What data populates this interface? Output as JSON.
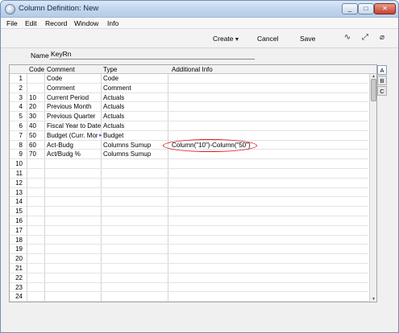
{
  "window": {
    "title": "Column Definition: New"
  },
  "menu": [
    "File",
    "Edit",
    "Record",
    "Window",
    "Info"
  ],
  "toolbar": {
    "create_label": "Create",
    "cancel_label": "Cancel",
    "save_label": "Save"
  },
  "header": {
    "name_label": "Name",
    "name_value": "KeyRn"
  },
  "grid": {
    "columns": [
      "Code",
      "Comment",
      "Type",
      "Additional Info"
    ],
    "rows": [
      {
        "num": "1",
        "code": "",
        "comment": "Code",
        "type": "Code",
        "info": ""
      },
      {
        "num": "2",
        "code": "",
        "comment": "Comment",
        "type": "Comment",
        "info": ""
      },
      {
        "num": "3",
        "code": "10",
        "comment": "Current Period",
        "type": "Actuals",
        "info": ""
      },
      {
        "num": "4",
        "code": "20",
        "comment": "Previous Month",
        "type": "Actuals",
        "info": ""
      },
      {
        "num": "5",
        "code": "30",
        "comment": "Previous Quarter",
        "type": "Actuals",
        "info": ""
      },
      {
        "num": "6",
        "code": "40",
        "comment": "Fiscal Year to Date",
        "type": "Actuals",
        "info": ""
      },
      {
        "num": "7",
        "code": "50",
        "comment": "Budget (Curr. Mor",
        "type": "Budget",
        "info": ""
      },
      {
        "num": "8",
        "code": "60",
        "comment": "Act-Budg",
        "type": "Columns Sumup",
        "info": "Column(\"10\")-Column(\"50\")"
      },
      {
        "num": "9",
        "code": "70",
        "comment": "Act/Budg %",
        "type": "Columns Sumup",
        "info": ""
      },
      {
        "num": "10",
        "code": "",
        "comment": "",
        "type": "",
        "info": ""
      },
      {
        "num": "11",
        "code": "",
        "comment": "",
        "type": "",
        "info": ""
      },
      {
        "num": "12",
        "code": "",
        "comment": "",
        "type": "",
        "info": ""
      },
      {
        "num": "13",
        "code": "",
        "comment": "",
        "type": "",
        "info": ""
      },
      {
        "num": "14",
        "code": "",
        "comment": "",
        "type": "",
        "info": ""
      },
      {
        "num": "15",
        "code": "",
        "comment": "",
        "type": "",
        "info": ""
      },
      {
        "num": "16",
        "code": "",
        "comment": "",
        "type": "",
        "info": ""
      },
      {
        "num": "17",
        "code": "",
        "comment": "",
        "type": "",
        "info": ""
      },
      {
        "num": "18",
        "code": "",
        "comment": "",
        "type": "",
        "info": ""
      },
      {
        "num": "19",
        "code": "",
        "comment": "",
        "type": "",
        "info": ""
      },
      {
        "num": "20",
        "code": "",
        "comment": "",
        "type": "",
        "info": ""
      },
      {
        "num": "21",
        "code": "",
        "comment": "",
        "type": "",
        "info": ""
      },
      {
        "num": "22",
        "code": "",
        "comment": "",
        "type": "",
        "info": ""
      },
      {
        "num": "23",
        "code": "",
        "comment": "",
        "type": "",
        "info": ""
      },
      {
        "num": "24",
        "code": "",
        "comment": "",
        "type": "",
        "info": ""
      }
    ]
  },
  "tabs": [
    "A",
    "B",
    "C"
  ],
  "colors": {
    "highlight": "#e01818",
    "titlebar": "#c3d6ee"
  }
}
